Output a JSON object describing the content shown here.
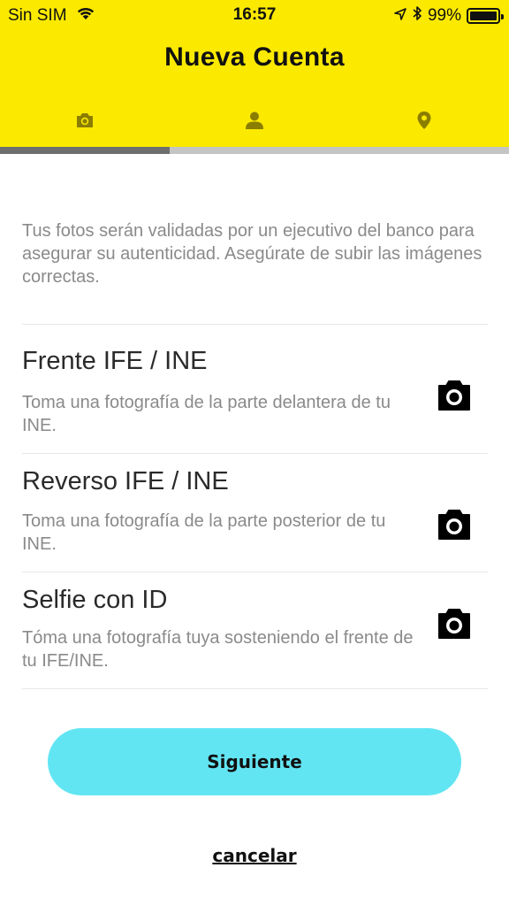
{
  "status_bar": {
    "carrier": "Sin SIM",
    "time": "16:57",
    "battery": "99%",
    "battery_level": 0.99,
    "icons": [
      "wifi-icon",
      "location-arrow-icon",
      "bluetooth-icon",
      "battery-icon"
    ]
  },
  "header": {
    "title": "Nueva Cuenta",
    "background_color": "#fbe900"
  },
  "tabs": [
    {
      "name": "tab-photos",
      "icon": "camera-icon",
      "active": true
    },
    {
      "name": "tab-profile",
      "icon": "person-icon",
      "active": false
    },
    {
      "name": "tab-location",
      "icon": "location-pin-icon",
      "active": false
    }
  ],
  "progress": {
    "step": 1,
    "total": 3,
    "fraction": 0.333
  },
  "intro": "Tus fotos serán validadas por un ejecutivo del banco para asegurar su autenticidad. Asegúrate de subir las imágenes correctas.",
  "documents": [
    {
      "title": "Frente IFE / INE",
      "description": "Toma una fotografía de la parte delantera de tu INE.",
      "icon": "camera-icon"
    },
    {
      "title": "Reverso IFE / INE",
      "description": "Toma una fotografía de la parte posterior de tu INE.",
      "icon": "camera-icon"
    },
    {
      "title": "Selfie con ID",
      "description": "Tóma una fotografía tuya sosteniendo el frente de tu IFE/INE.",
      "icon": "camera-icon"
    }
  ],
  "actions": {
    "next_label": "Siguiente",
    "cancel_label": "cancelar",
    "next_color": "#62e5f3"
  }
}
